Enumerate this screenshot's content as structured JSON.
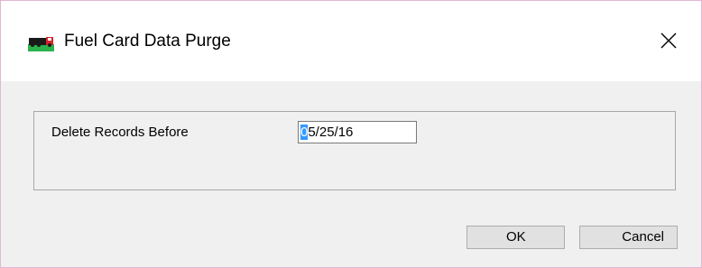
{
  "window": {
    "title": "Fuel Card Data Purge",
    "icon": "truck-app-icon",
    "close_icon": "close-icon"
  },
  "form": {
    "delete_label": "Delete Records Before",
    "date_value_selected": "0",
    "date_value_rest": "5/25/16"
  },
  "buttons": {
    "ok_label": "OK",
    "cancel_label": "Cancel"
  },
  "colors": {
    "selection": "#3399ff",
    "window_border": "#e2b6d2",
    "dialog_background": "#f0f0f0"
  }
}
